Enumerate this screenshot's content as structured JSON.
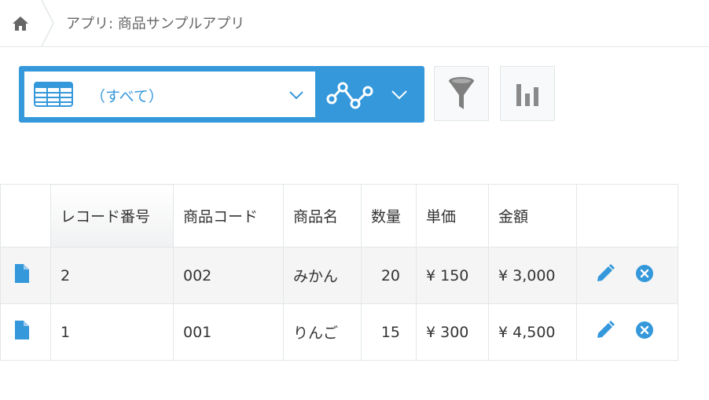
{
  "breadcrumb": {
    "home_icon": "home-icon",
    "app_label": "アプリ: 商品サンプルアプリ"
  },
  "view": {
    "selected": "（すべて）",
    "icon": "table-view-icon"
  },
  "toolbar": {
    "graph_icon": "line-graph-icon",
    "filter_icon": "filter-icon",
    "chart_icon": "bar-chart-icon"
  },
  "colors": {
    "accent": "#3498db",
    "text": "#333333",
    "border": "#e3e7e8",
    "row_alt": "#f5f5f5"
  },
  "table": {
    "headers": [
      "レコード番号",
      "商品コード",
      "商品名",
      "数量",
      "単価",
      "金額"
    ],
    "rows": [
      {
        "record_no": "2",
        "code": "002",
        "name": "みかん",
        "qty": "20",
        "unit_price": "¥ 150",
        "amount": "¥ 3,000"
      },
      {
        "record_no": "1",
        "code": "001",
        "name": "りんご",
        "qty": "15",
        "unit_price": "¥ 300",
        "amount": "¥ 4,500"
      }
    ]
  }
}
